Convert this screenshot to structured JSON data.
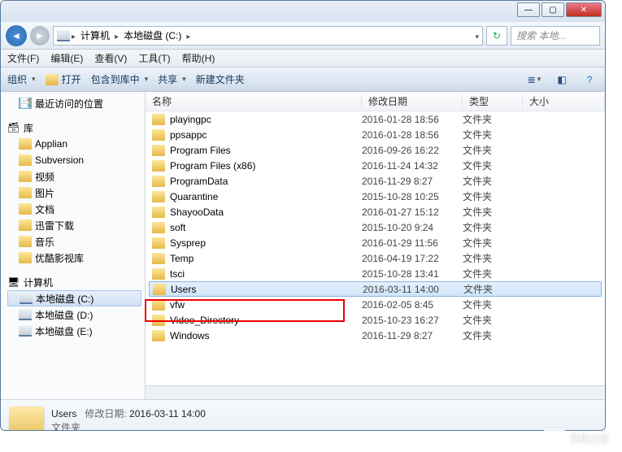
{
  "titlebar": {
    "min": "—",
    "max": "▢",
    "close": "✕"
  },
  "nav": {
    "path_icon": "computer",
    "crumbs": [
      "计算机",
      "本地磁盘 (C:)"
    ],
    "refresh": "↻",
    "search_placeholder": "搜索 本地..."
  },
  "menubar": [
    "文件(F)",
    "编辑(E)",
    "查看(V)",
    "工具(T)",
    "帮助(H)"
  ],
  "toolbar": {
    "organize": "组织",
    "open": "打开",
    "include": "包含到库中",
    "share": "共享",
    "newfolder": "新建文件夹"
  },
  "sidebar": {
    "recent": "最近访问的位置",
    "lib_header": "库",
    "libs": [
      "Applian",
      "Subversion",
      "视频",
      "图片",
      "文档",
      "迅雷下载",
      "音乐",
      "优酷影视库"
    ],
    "computer_header": "计算机",
    "drives": [
      "本地磁盘 (C:)",
      "本地磁盘 (D:)",
      "本地磁盘 (E:)"
    ]
  },
  "columns": {
    "name": "名称",
    "date": "修改日期",
    "type": "类型",
    "size": "大小"
  },
  "files": [
    {
      "name": "playingpc",
      "date": "2016-01-28 18:56",
      "type": "文件夹"
    },
    {
      "name": "ppsappc",
      "date": "2016-01-28 18:56",
      "type": "文件夹"
    },
    {
      "name": "Program Files",
      "date": "2016-09-26 16:22",
      "type": "文件夹"
    },
    {
      "name": "Program Files (x86)",
      "date": "2016-11-24 14:32",
      "type": "文件夹"
    },
    {
      "name": "ProgramData",
      "date": "2016-11-29 8:27",
      "type": "文件夹"
    },
    {
      "name": "Quarantine",
      "date": "2015-10-28 10:25",
      "type": "文件夹"
    },
    {
      "name": "ShayooData",
      "date": "2016-01-27 15:12",
      "type": "文件夹"
    },
    {
      "name": "soft",
      "date": "2015-10-20 9:24",
      "type": "文件夹"
    },
    {
      "name": "Sysprep",
      "date": "2016-01-29 11:56",
      "type": "文件夹"
    },
    {
      "name": "Temp",
      "date": "2016-04-19 17:22",
      "type": "文件夹"
    },
    {
      "name": "tsci",
      "date": "2015-10-28 13:41",
      "type": "文件夹"
    },
    {
      "name": "Users",
      "date": "2016-03-11 14:00",
      "type": "文件夹",
      "selected": true
    },
    {
      "name": "vfw",
      "date": "2016-02-05 8:45",
      "type": "文件夹"
    },
    {
      "name": "Video_Directory",
      "date": "2015-10-23 16:27",
      "type": "文件夹"
    },
    {
      "name": "Windows",
      "date": "2016-11-29 8:27",
      "type": "文件夹"
    }
  ],
  "details": {
    "name": "Users",
    "date_label": "修改日期:",
    "date": "2016-03-11 14:00",
    "type": "文件夹"
  },
  "watermark": {
    "text": "系统之家",
    "sub": ""
  }
}
